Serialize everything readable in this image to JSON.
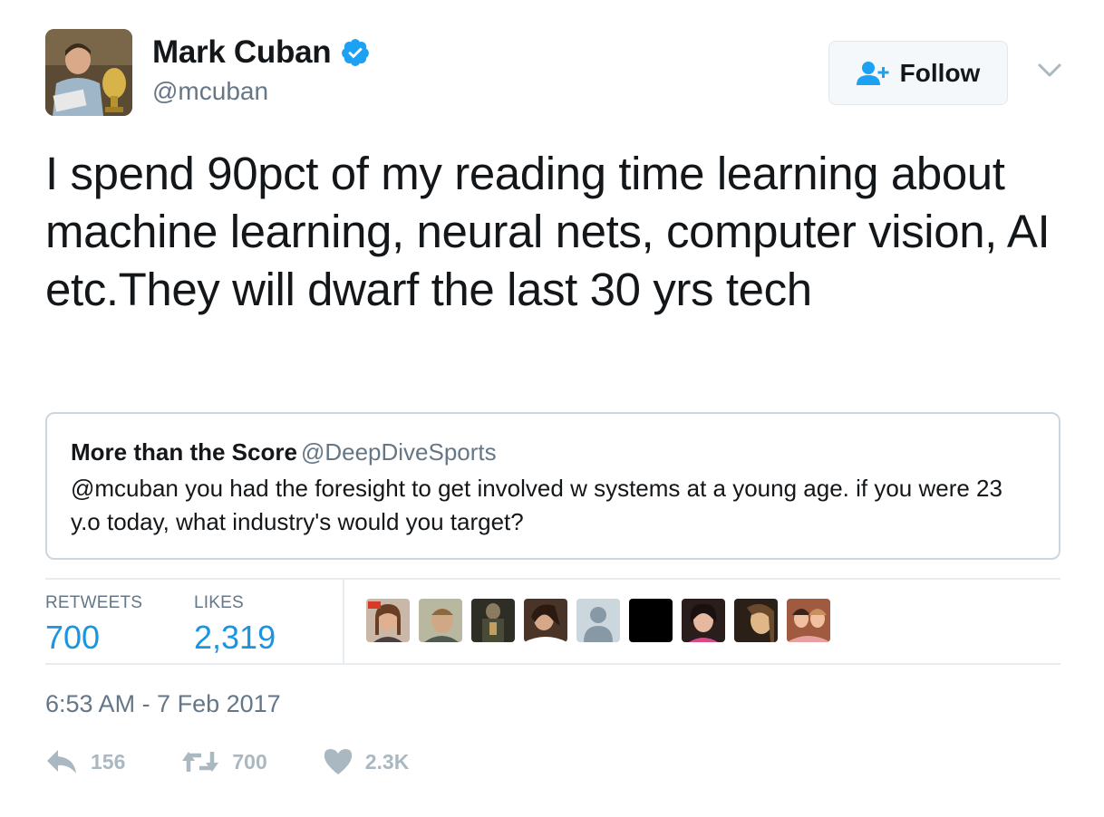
{
  "author": {
    "display_name": "Mark Cuban",
    "handle": "@mcuban",
    "verified": true
  },
  "follow_button": {
    "label": "Follow",
    "icon": "add-user-icon"
  },
  "menu": {
    "icon": "chevron-down-icon"
  },
  "tweet": {
    "text": "I spend 90pct of my reading time learning about machine learning, neural nets, computer vision, AI etc.They will dwarf the last 30 yrs tech"
  },
  "quoted_tweet": {
    "display_name": "More than the Score",
    "handle": "@DeepDiveSports",
    "text": "@mcuban you had the foresight to get involved w systems at a young age. if you were 23 y.o today, what industry's would you target?"
  },
  "stats": {
    "retweets_label": "RETWEETS",
    "retweets_value": "700",
    "likes_label": "LIKES",
    "likes_value": "2,319"
  },
  "likers": [
    {
      "name": "liker-1",
      "color": "#a9785a"
    },
    {
      "name": "liker-2",
      "color": "#8a8f7a"
    },
    {
      "name": "liker-3",
      "color": "#3a3a30"
    },
    {
      "name": "liker-4",
      "color": "#6a4a3a"
    },
    {
      "name": "liker-5",
      "color": "#ccd6dd"
    },
    {
      "name": "liker-6",
      "color": "#000000"
    },
    {
      "name": "liker-7",
      "color": "#3a2a28"
    },
    {
      "name": "liker-8",
      "color": "#c9a070"
    },
    {
      "name": "liker-9",
      "color": "#c07a5a"
    }
  ],
  "timestamp": "6:53 AM - 7 Feb 2017",
  "actions": {
    "reply_count": "156",
    "retweet_count": "700",
    "like_count": "2.3K"
  },
  "colors": {
    "link_blue": "#1b95e0",
    "muted_gray": "#657786",
    "action_gray": "#aab8c2",
    "verified_blue": "#1da1f2"
  }
}
